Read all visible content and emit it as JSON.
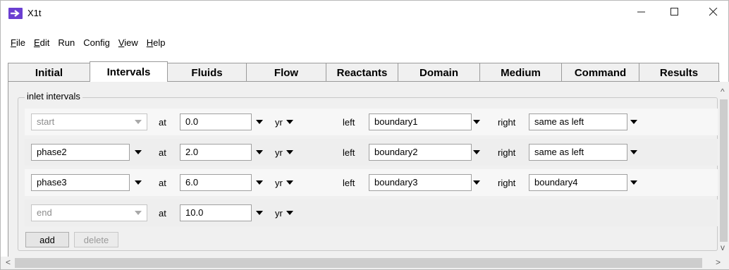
{
  "window": {
    "title": "X1t"
  },
  "menu": [
    {
      "label": "File",
      "u": "F",
      "rest": "ile"
    },
    {
      "label": "Edit",
      "u": "E",
      "rest": "dit"
    },
    {
      "label": "Run",
      "u": "",
      "rest": "Run"
    },
    {
      "label": "Config",
      "u": "",
      "rest": "Config"
    },
    {
      "label": "View",
      "u": "V",
      "rest": "iew"
    },
    {
      "label": "Help",
      "u": "H",
      "rest": "elp"
    }
  ],
  "tabs": [
    "Initial",
    "Intervals",
    "Fluids",
    "Flow",
    "Reactants",
    "Domain",
    "Medium",
    "Command",
    "Results"
  ],
  "active_tab": "Intervals",
  "group": {
    "label": "inlet intervals"
  },
  "intervals": [
    {
      "name": "start",
      "name_enabled": false,
      "at_label": "at",
      "time": "0.0",
      "unit": "yr",
      "left_label": "left",
      "left": "boundary1",
      "right_label": "right",
      "right": "same as left"
    },
    {
      "name": "phase2",
      "name_enabled": true,
      "at_label": "at",
      "time": "2.0",
      "unit": "yr",
      "left_label": "left",
      "left": "boundary2",
      "right_label": "right",
      "right": "same as left"
    },
    {
      "name": "phase3",
      "name_enabled": true,
      "at_label": "at",
      "time": "6.0",
      "unit": "yr",
      "left_label": "left",
      "left": "boundary3",
      "right_label": "right",
      "right": "boundary4"
    },
    {
      "name": "end",
      "name_enabled": false,
      "at_label": "at",
      "time": "10.0",
      "unit": "yr"
    }
  ],
  "buttons": {
    "add": "add",
    "delete": "delete"
  },
  "scroll": {
    "up": "^",
    "down": "v",
    "left": "<",
    "right": ">"
  }
}
